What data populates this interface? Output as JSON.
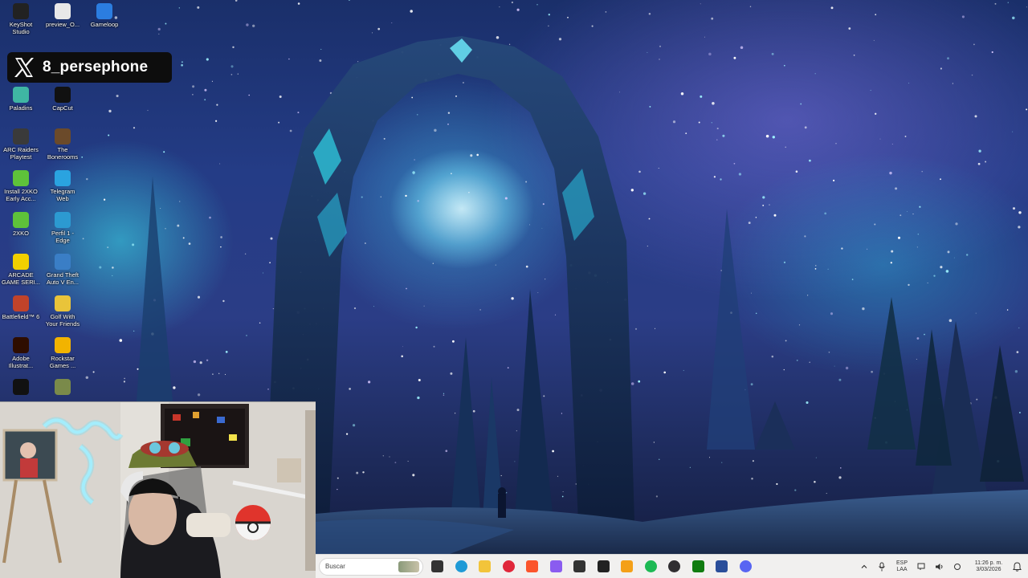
{
  "overlay": {
    "handle": "8_persephone"
  },
  "desktop_icons": [
    {
      "label": "KeyShot\nStudio",
      "icon": "keyshot-icon",
      "color": "#222"
    },
    {
      "label": "preview_O...",
      "icon": "document-icon",
      "color": "#e8e8e8"
    },
    {
      "label": "Gameloop",
      "icon": "gameloop-icon",
      "color": "#2b7de0"
    },
    {
      "label": "Paladins",
      "icon": "paladins-icon",
      "color": "#3fb6a3"
    },
    {
      "label": "CapCut",
      "icon": "capcut-icon",
      "color": "#111"
    },
    {
      "label": "ARC Raiders\nPlaytest",
      "icon": "arc-raiders-icon",
      "color": "#3a3a3a"
    },
    {
      "label": "The\nBonerooms",
      "icon": "bonerooms-icon",
      "color": "#6b4a2a"
    },
    {
      "label": "Install 2XKO\nEarly Acc...",
      "icon": "2xko-icon",
      "color": "#5ec23a"
    },
    {
      "label": "Telegram\nWeb",
      "icon": "telegram-icon",
      "color": "#2aa3e0"
    },
    {
      "label": "2XKO",
      "icon": "2xko-icon",
      "color": "#5ec23a"
    },
    {
      "label": "Perfil 1 -\nEdge",
      "icon": "edge-icon",
      "color": "#2c9ad1"
    },
    {
      "label": "ARCADE\nGAME SERI...",
      "icon": "arcade-icon",
      "color": "#f2d000"
    },
    {
      "label": "Grand Theft\nAuto V En...",
      "icon": "gta-icon",
      "color": "#3a7ec6"
    },
    {
      "label": "Battlefield™ 6",
      "icon": "battlefield-icon",
      "color": "#c0432a"
    },
    {
      "label": "Golf With\nYour Friends",
      "icon": "golf-icon",
      "color": "#e9c43a"
    },
    {
      "label": "Adobe\nIllustrat...",
      "icon": "illustrator-icon",
      "color": "#2e0d00"
    },
    {
      "label": "Rockstar\nGames ...",
      "icon": "rockstar-icon",
      "color": "#f2b300"
    },
    {
      "label": "",
      "icon": "app-icon",
      "color": "#111"
    },
    {
      "label": "",
      "icon": "app-icon",
      "color": "#7a8a4a"
    }
  ],
  "taskbar": {
    "search_placeholder": "Buscar",
    "apps": [
      {
        "name": "taskview-icon",
        "color": "#333"
      },
      {
        "name": "edge-icon",
        "color": "#1f9ad6"
      },
      {
        "name": "file-explorer-icon",
        "color": "#f2c43a"
      },
      {
        "name": "opera-icon",
        "color": "#e0273a"
      },
      {
        "name": "brave-icon",
        "color": "#fb542b"
      },
      {
        "name": "copilot-icon",
        "color": "#8a5cf0"
      },
      {
        "name": "unity-icon",
        "color": "#333"
      },
      {
        "name": "arc-icon",
        "color": "#222"
      },
      {
        "name": "paint-icon",
        "color": "#f4a018"
      },
      {
        "name": "spotify-icon",
        "color": "#1db954"
      },
      {
        "name": "obs-icon",
        "color": "#302e31"
      },
      {
        "name": "xbox-icon",
        "color": "#107c10"
      },
      {
        "name": "calculator-icon",
        "color": "#2a4e9a"
      },
      {
        "name": "discord-icon",
        "color": "#5865f2"
      }
    ],
    "lang_line1": "ESP",
    "lang_line2": "LAA",
    "time": "11:26 p. m.",
    "date": "3/03/2026"
  }
}
